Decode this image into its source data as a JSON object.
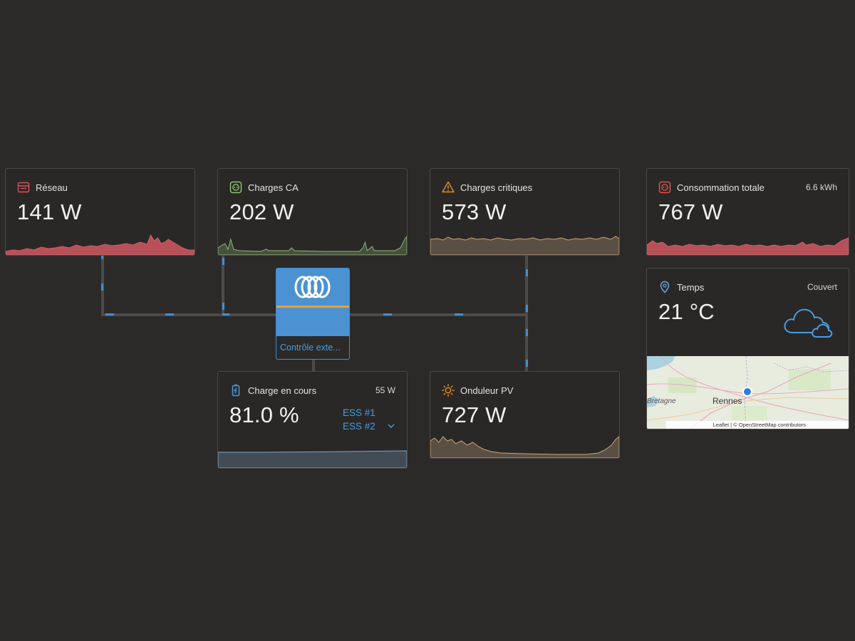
{
  "grid": {
    "title": "Réseau",
    "value": "141 W",
    "color": "#e05050"
  },
  "ac_loads": {
    "title": "Charges CA",
    "value": "202 W",
    "color": "#8cc36e"
  },
  "critical_loads": {
    "title": "Charges critiques",
    "value": "573 W",
    "color": "#e08a2a"
  },
  "total_consumption": {
    "title": "Consommation totale",
    "value": "767 W",
    "extra": "6.6 kWh"
  },
  "weather": {
    "title": "Temps",
    "value": "21 °C",
    "condition": "Couvert"
  },
  "inverter": {
    "label": "Contrôle exte..."
  },
  "battery": {
    "title": "Charge en cours",
    "value": "81.0 %",
    "power": "55 W",
    "ess_links": [
      "ESS #1",
      "ESS #2"
    ]
  },
  "pv_inverter": {
    "title": "Onduleur PV",
    "value": "727 W"
  },
  "map": {
    "label_city": "Rennes",
    "label_region": "Bretagne",
    "attribution": "Leaflet | © OpenStreetMap contributors"
  }
}
